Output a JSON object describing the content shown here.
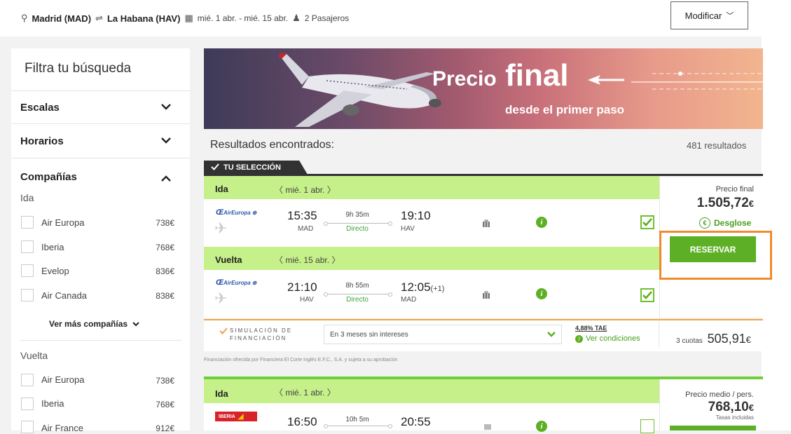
{
  "search": {
    "origin": "Madrid (MAD)",
    "destination": "La Habana (HAV)",
    "dates": "mié. 1 abr. - mié. 15 abr.",
    "passengers": "2 Pasajeros",
    "modify_label": "Modificar"
  },
  "sidebar": {
    "title": "Filtra tu búsqueda",
    "sections": [
      {
        "label": "Escalas",
        "expanded": false
      },
      {
        "label": "Horarios",
        "expanded": false
      },
      {
        "label": "Compañías",
        "expanded": true
      }
    ],
    "ida_label": "Ida",
    "ida_airlines": [
      {
        "name": "Air Europa",
        "price": "738€"
      },
      {
        "name": "Iberia",
        "price": "768€"
      },
      {
        "name": "Evelop",
        "price": "836€"
      },
      {
        "name": "Air Canada",
        "price": "838€"
      }
    ],
    "more_label": "Ver más compañías",
    "vuelta_label": "Vuelta",
    "vuelta_airlines": [
      {
        "name": "Air Europa",
        "price": "738€"
      },
      {
        "name": "Iberia",
        "price": "768€"
      },
      {
        "name": "Air France",
        "price": "912€"
      }
    ]
  },
  "banner": {
    "precio": "Precio",
    "final": "final",
    "subtitle": "desde el primer paso"
  },
  "results": {
    "title": "Resultados encontrados:",
    "count": "481 resultados",
    "selection_tab": "TU SELECCIÓN"
  },
  "card1": {
    "ida": {
      "label": "Ida",
      "date": "mié. 1 abr.",
      "airline": "AirEuropa",
      "dep_time": "15:35",
      "dep_airport": "MAD",
      "duration": "9h 35m",
      "stops": "Directo",
      "arr_time": "19:10",
      "arr_airport": "HAV"
    },
    "vuelta": {
      "label": "Vuelta",
      "date": "mié. 15 abr.",
      "airline": "AirEuropa",
      "dep_time": "21:10",
      "dep_airport": "HAV",
      "duration": "8h 55m",
      "stops": "Directo",
      "arr_time": "12:05",
      "arr_plus": "(+1)",
      "arr_airport": "MAD"
    },
    "price_label": "Precio final",
    "price": "1.505,72",
    "currency": "€",
    "breakdown_label": "Desglose",
    "reserve_label": "RESERVAR"
  },
  "financing": {
    "title_line1": "SIMULACIÓN DE",
    "title_line2": "FINANCIACIÓN",
    "option": "En 3 meses sin intereses",
    "tae": "4,88% TAE",
    "conditions": "Ver condiciones",
    "installments_label": "3 cuotas",
    "installment_amount": "505,91",
    "currency": "€",
    "disclaimer": "Financiación ofrecida por Financiera El Corte Inglés E.F.C., S.A. y sujeta a su aprobación"
  },
  "card2": {
    "ida": {
      "label": "Ida",
      "date": "mié. 1 abr.",
      "airline": "IBERIA",
      "dep_time": "16:50",
      "duration": "10h 5m",
      "arr_time": "20:55"
    },
    "price_label": "Precio medio / pers.",
    "price": "768,10",
    "currency": "€",
    "tax_note": "Tasas incluidas"
  }
}
